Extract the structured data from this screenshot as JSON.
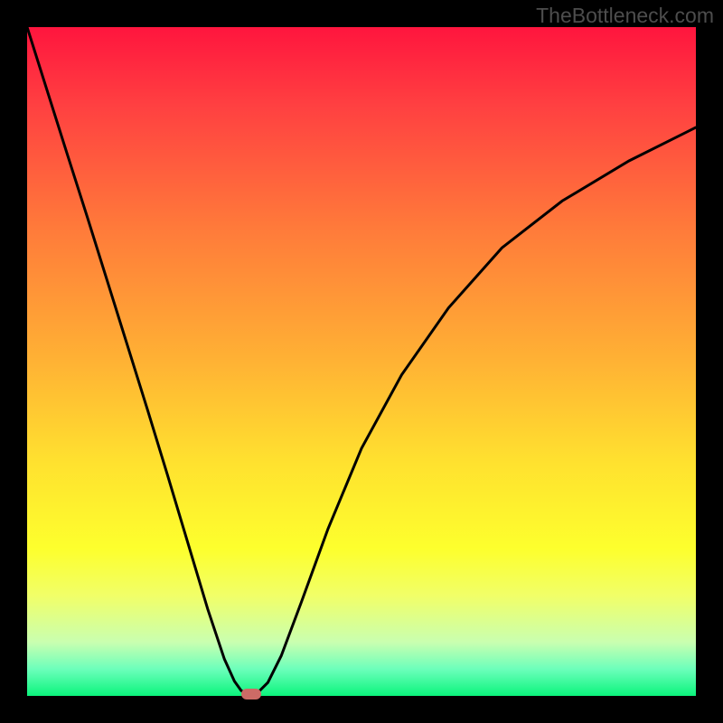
{
  "watermark": "TheBottleneck.com",
  "chart_data": {
    "type": "line",
    "title": "",
    "xlabel": "",
    "ylabel": "",
    "xlim": [
      0,
      1
    ],
    "ylim": [
      0,
      1
    ],
    "notes": "Plot area shows a vertical red→yellow→green gradient with a black V-shaped curve whose minimum touches the bottom; no numeric axes are visible so values are normalized.",
    "series": [
      {
        "name": "left-branch",
        "x": [
          0.0,
          0.03,
          0.06,
          0.09,
          0.12,
          0.15,
          0.18,
          0.21,
          0.24,
          0.27,
          0.295,
          0.31,
          0.32,
          0.325
        ],
        "y": [
          1.0,
          0.905,
          0.81,
          0.716,
          0.62,
          0.524,
          0.428,
          0.33,
          0.23,
          0.13,
          0.055,
          0.022,
          0.008,
          0.005
        ]
      },
      {
        "name": "right-branch",
        "x": [
          0.345,
          0.36,
          0.38,
          0.41,
          0.45,
          0.5,
          0.56,
          0.63,
          0.71,
          0.8,
          0.9,
          1.0
        ],
        "y": [
          0.005,
          0.02,
          0.06,
          0.14,
          0.25,
          0.37,
          0.48,
          0.58,
          0.67,
          0.74,
          0.8,
          0.85
        ]
      }
    ],
    "marker": {
      "x": 0.335,
      "y": 0.003
    },
    "gradient_stops": [
      {
        "pos": 0.0,
        "color": "#ff153e"
      },
      {
        "pos": 0.12,
        "color": "#ff4141"
      },
      {
        "pos": 0.3,
        "color": "#ff7a3a"
      },
      {
        "pos": 0.5,
        "color": "#ffb234"
      },
      {
        "pos": 0.65,
        "color": "#ffe12f"
      },
      {
        "pos": 0.78,
        "color": "#fdff2d"
      },
      {
        "pos": 0.85,
        "color": "#f1ff68"
      },
      {
        "pos": 0.92,
        "color": "#c9ffb0"
      },
      {
        "pos": 0.96,
        "color": "#6cffbb"
      },
      {
        "pos": 1.0,
        "color": "#0bf47c"
      }
    ]
  }
}
